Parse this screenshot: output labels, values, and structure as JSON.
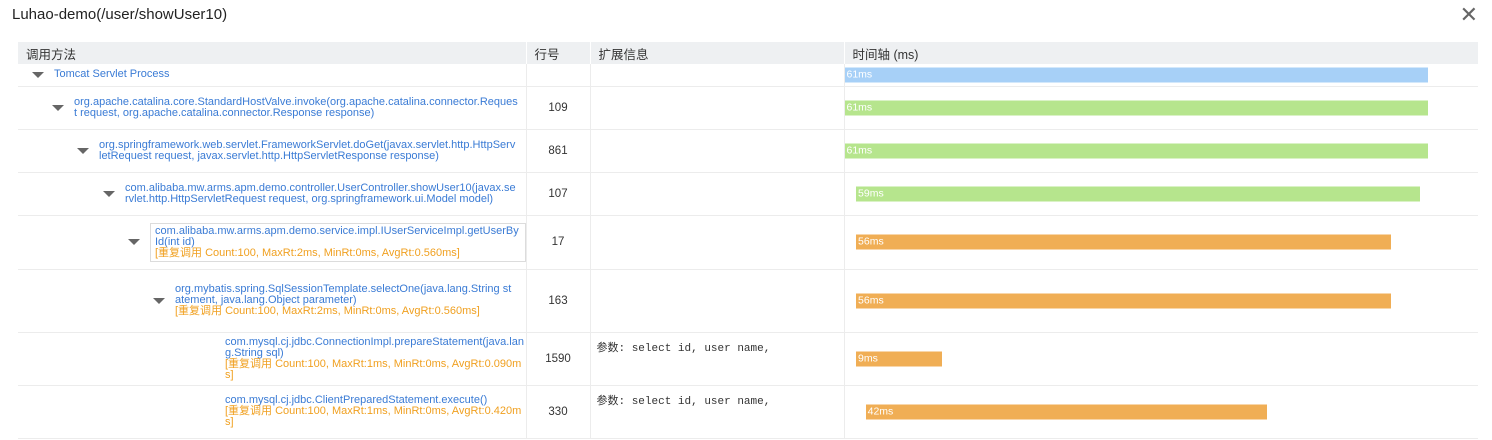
{
  "title": "Luhao-demo(/user/showUser10)",
  "close_label": "✕",
  "headers": {
    "method": "调用方法",
    "line": "行号",
    "ext": "扩展信息",
    "timeline": "时间轴 (ms)"
  },
  "timeline_scale_ms": 61,
  "colors": {
    "root_bar": "#a7d0f7",
    "normal_bar": "#b6e58d",
    "slow_bar": "#f0ae55",
    "method_text": "#3a7bd5",
    "repeat_text": "#f0a020"
  },
  "rows": [
    {
      "method": "Tomcat Servlet Process",
      "extra": "",
      "line": "",
      "ext": "",
      "start": 0,
      "duration": 61,
      "label": "61ms",
      "color": "root_bar",
      "has_caret": true
    },
    {
      "method": "org.apache.catalina.core.StandardHostValve.invoke(org.apache.catalina.connector.Request request, org.apache.catalina.connector.Response response)",
      "extra": "",
      "line": "109",
      "ext": "",
      "start": 0,
      "duration": 61,
      "label": "61ms",
      "color": "normal_bar",
      "has_caret": true
    },
    {
      "method": "org.springframework.web.servlet.FrameworkServlet.doGet(javax.servlet.http.HttpServletRequest request, javax.servlet.http.HttpServletResponse response)",
      "extra": "",
      "line": "861",
      "ext": "",
      "start": 0,
      "duration": 61,
      "label": "61ms",
      "color": "normal_bar",
      "has_caret": true
    },
    {
      "method": "com.alibaba.mw.arms.apm.demo.controller.UserController.showUser10(javax.servlet.http.HttpServletRequest request, org.springframework.ui.Model model)",
      "extra": "",
      "line": "107",
      "ext": "",
      "start": 1,
      "duration": 59,
      "label": "59ms",
      "color": "normal_bar",
      "has_caret": true
    },
    {
      "method": "com.alibaba.mw.arms.apm.demo.service.impl.IUserServiceImpl.getUserById(int id)",
      "extra": "[重复调用 Count:100, MaxRt:2ms, MinRt:0ms, AvgRt:0.560ms]",
      "line": "17",
      "ext": "",
      "start": 1,
      "duration": 56,
      "label": "56ms",
      "color": "slow_bar",
      "has_caret": true
    },
    {
      "method": "org.mybatis.spring.SqlSessionTemplate.selectOne(java.lang.String statement, java.lang.Object parameter)",
      "extra": "[重复调用 Count:100, MaxRt:2ms, MinRt:0ms, AvgRt:0.560ms]",
      "line": "163",
      "ext": "",
      "start": 1,
      "duration": 56,
      "label": "56ms",
      "color": "slow_bar",
      "has_caret": true
    },
    {
      "method": "com.mysql.cj.jdbc.ConnectionImpl.prepareStatement(java.lang.String sql)",
      "extra": "[重复调用 Count:100, MaxRt:1ms, MinRt:0ms, AvgRt:0.090ms]",
      "line": "1590",
      "ext": "参数: select id, user name,",
      "start": 1,
      "duration": 9,
      "label": "9ms",
      "color": "slow_bar",
      "has_caret": false
    },
    {
      "method": "com.mysql.cj.jdbc.ClientPreparedStatement.execute()",
      "extra": "[重复调用 Count:100, MaxRt:1ms, MinRt:0ms, AvgRt:0.420ms]",
      "line": "330",
      "ext": "参数: select id, user name,",
      "start": 2,
      "duration": 42,
      "label": "42ms",
      "color": "slow_bar",
      "has_caret": false
    }
  ]
}
